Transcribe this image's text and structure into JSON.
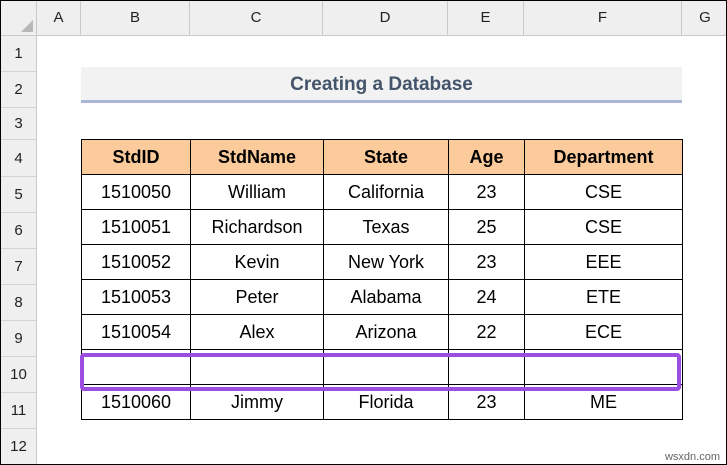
{
  "sheet": {
    "columns": [
      "A",
      "B",
      "C",
      "D",
      "E",
      "F",
      "G"
    ],
    "rows": [
      "1",
      "2",
      "3",
      "4",
      "5",
      "6",
      "7",
      "8",
      "9",
      "10",
      "11",
      "12"
    ]
  },
  "title": "Creating a Database",
  "table": {
    "headers": [
      "StdID",
      "StdName",
      "State",
      "Age",
      "Department"
    ],
    "rows": [
      [
        "1510050",
        "William",
        "California",
        "23",
        "CSE"
      ],
      [
        "1510051",
        "Richardson",
        "Texas",
        "25",
        "CSE"
      ],
      [
        "1510052",
        "Kevin",
        "New York",
        "23",
        "EEE"
      ],
      [
        "1510053",
        "Peter",
        "Alabama",
        "24",
        "ETE"
      ],
      [
        "1510054",
        "Alex",
        "Arizona",
        "22",
        "ECE"
      ],
      [
        "",
        "",
        "",
        "",
        ""
      ],
      [
        "1510060",
        "Jimmy",
        "Florida",
        "23",
        "ME"
      ]
    ]
  },
  "highlight_color": "#9b4ee0",
  "header_fill_color": "#fccb9b",
  "watermark": "wsxdn.com"
}
